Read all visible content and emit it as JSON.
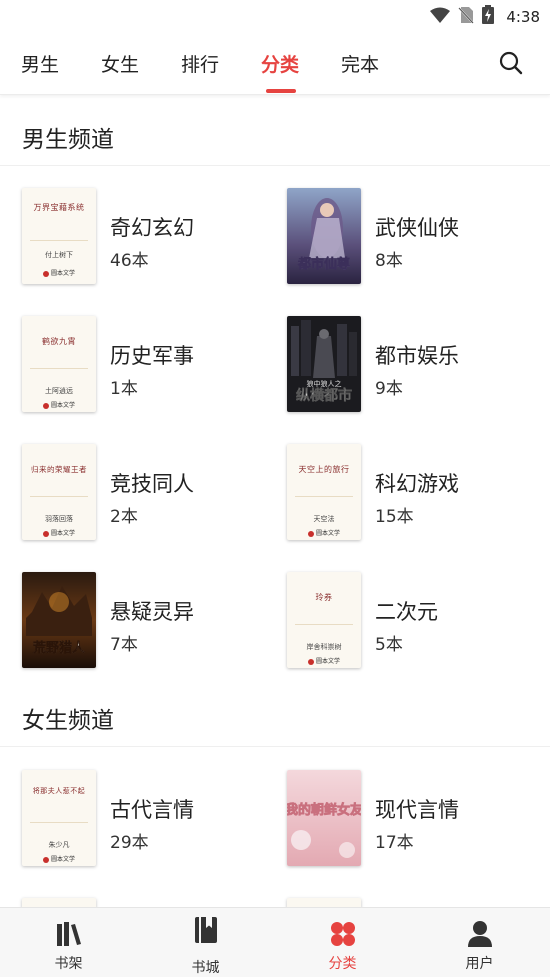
{
  "status_bar": {
    "time": "4:38",
    "icons": [
      "wifi-icon",
      "no-sim-icon",
      "battery-charging-icon"
    ]
  },
  "top_tabs": {
    "tabs": [
      {
        "label": "男生"
      },
      {
        "label": "女生"
      },
      {
        "label": "排行"
      },
      {
        "label": "分类",
        "active": true
      },
      {
        "label": "完本"
      }
    ],
    "search_icon": "search-icon",
    "accent_color": "#e64340"
  },
  "sections": [
    {
      "title": "男生频道",
      "categories": [
        {
          "name": "奇幻玄幻",
          "count": "46本",
          "cover": {
            "title": "万界宝藉系统",
            "author": "付上树下",
            "publisher": "圆本文学"
          }
        },
        {
          "name": "武侠仙侠",
          "count": "8本",
          "cover": {
            "title": "都市仙尊"
          }
        },
        {
          "name": "历史军事",
          "count": "1本",
          "cover": {
            "title": "鹤欲九霄",
            "author": "土阿逍远",
            "publisher": "圆本文学"
          }
        },
        {
          "name": "都市娱乐",
          "count": "9本",
          "cover": {
            "title": "纵横都市",
            "subtitle": "狼中狼人之"
          }
        },
        {
          "name": "竞技同人",
          "count": "2本",
          "cover": {
            "title": "归来的荣耀王者",
            "author": "羽落回落",
            "publisher": "圆本文学"
          }
        },
        {
          "name": "科幻游戏",
          "count": "15本",
          "cover": {
            "title": "天空上的旅行",
            "author": "天空法",
            "publisher": "圆本文学"
          }
        },
        {
          "name": "悬疑灵异",
          "count": "7本",
          "cover": {
            "title": "荒野猎人"
          }
        },
        {
          "name": "二次元",
          "count": "5本",
          "cover": {
            "title": "玲券",
            "author": "岸舍科崇树",
            "publisher": "圆本文学"
          }
        }
      ]
    },
    {
      "title": "女生频道",
      "categories": [
        {
          "name": "古代言情",
          "count": "29本",
          "cover": {
            "title": "将那夫人惹不起",
            "author": "朱少凡",
            "publisher": "圆本文学"
          }
        },
        {
          "name": "现代言情",
          "count": "17本",
          "cover": {
            "title": "我的朝鲜女友"
          }
        }
      ]
    }
  ],
  "bottom_nav": {
    "items": [
      {
        "label": "书架",
        "icon": "bookshelf-icon"
      },
      {
        "label": "书城",
        "icon": "book-icon"
      },
      {
        "label": "分类",
        "icon": "category-icon",
        "active": true
      },
      {
        "label": "用户",
        "icon": "user-icon"
      }
    ]
  }
}
